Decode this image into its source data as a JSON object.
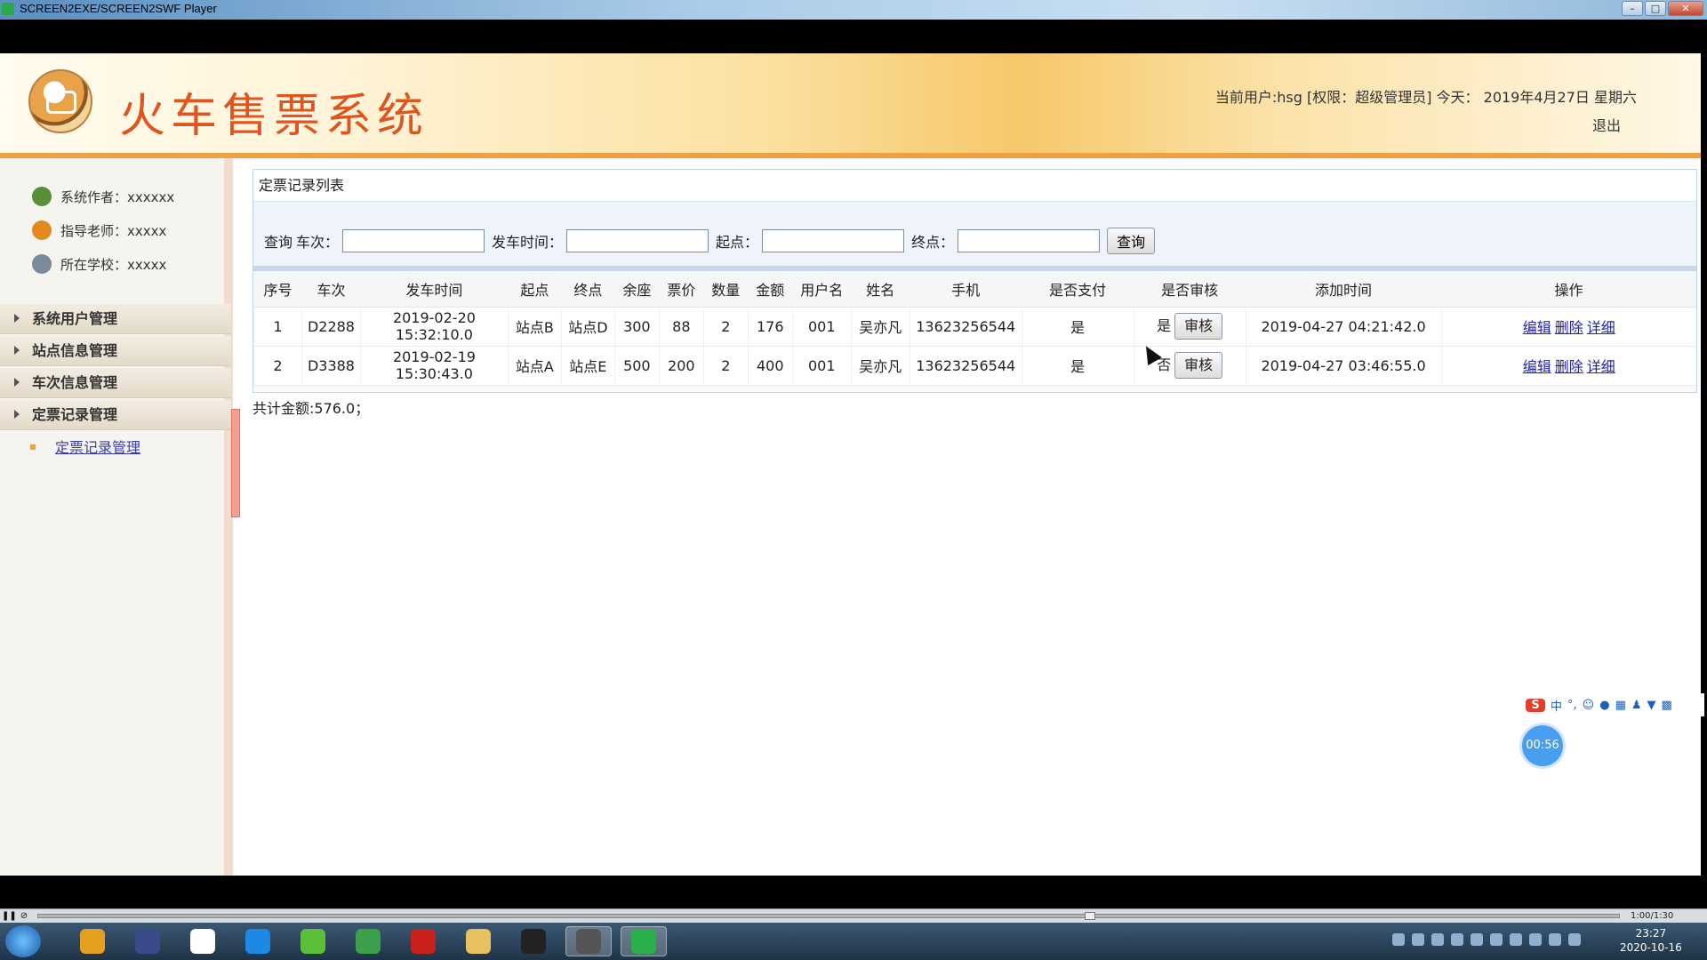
{
  "window": {
    "title": "SCREEN2EXE/SCREEN2SWF Player",
    "min": "–",
    "max": "□",
    "close": "✕"
  },
  "header": {
    "app_title": "火车售票系统",
    "user_info": "当前用户:hsg [权限：超级管理员] 今天： 2019年4月27日 星期六",
    "logout": "退出"
  },
  "sidebar": {
    "info": [
      {
        "text": "系统作者：xxxxxx",
        "icon": "users-icon",
        "color": "#5a8f3a"
      },
      {
        "text": "指导老师：xxxxx",
        "icon": "teacher-icon",
        "color": "#e08a20"
      },
      {
        "text": "所在学校：xxxxx",
        "icon": "school-icon",
        "color": "#7a8a9a"
      }
    ],
    "menus": [
      "系统用户管理",
      "站点信息管理",
      "车次信息管理",
      "定票记录管理"
    ],
    "submenu": "定票记录管理"
  },
  "panel": {
    "title": "定票记录列表",
    "search": {
      "prefix": "查询",
      "train_label": "车次：",
      "depart_label": "发车时间：",
      "from_label": "起点：",
      "to_label": "终点：",
      "button": "查询"
    },
    "columns": [
      "序号",
      "车次",
      "发车时间",
      "起点",
      "终点",
      "余座",
      "票价",
      "数量",
      "金额",
      "用户名",
      "姓名",
      "手机",
      "是否支付",
      "是否审核",
      "添加时间",
      "操作"
    ],
    "rows": [
      {
        "no": "1",
        "train": "D2288",
        "depart": "2019-02-20 15:32:10.0",
        "from": "站点B",
        "to": "站点D",
        "seats": "300",
        "price": "88",
        "qty": "2",
        "amount": "176",
        "username": "001",
        "name": "吴亦凡",
        "phone": "13623256544",
        "paid": "是",
        "audited": "是",
        "added": "2019-04-27 04:21:42.0"
      },
      {
        "no": "2",
        "train": "D3388",
        "depart": "2019-02-19 15:30:43.0",
        "from": "站点A",
        "to": "站点E",
        "seats": "500",
        "price": "200",
        "qty": "2",
        "amount": "400",
        "username": "001",
        "name": "吴亦凡",
        "phone": "13623256544",
        "paid": "是",
        "audited": "否",
        "added": "2019-04-27 03:46:55.0"
      }
    ],
    "audit_button": "审核",
    "actions": [
      "编辑",
      "删除",
      "详细"
    ],
    "total": "共计金额:576.0；"
  },
  "overlay": {
    "ime_label": "中",
    "ime_logo": "S",
    "timer": "00:56"
  },
  "player": {
    "time": "1:00/1:30"
  },
  "taskbar": {
    "apps": [
      {
        "icon": "chrome-icon",
        "color": "#e5a020"
      },
      {
        "icon": "editor-icon",
        "color": "#3a4a8a"
      },
      {
        "icon": "netdisk-icon",
        "color": "#ffffff"
      },
      {
        "icon": "browser-icon",
        "color": "#1e88e5"
      },
      {
        "icon": "leaf-icon",
        "color": "#5cbf3a"
      },
      {
        "icon": "chart-icon",
        "color": "#3aa04a"
      },
      {
        "icon": "flash-icon",
        "color": "#c8201a"
      },
      {
        "icon": "explorer-icon",
        "color": "#e8c060"
      },
      {
        "icon": "qq-icon",
        "color": "#222222"
      },
      {
        "icon": "avatar-icon",
        "color": "#555555"
      },
      {
        "icon": "player-icon",
        "color": "#2ab04a"
      }
    ],
    "clock_time": "23:27",
    "clock_date": "2020-10-16"
  }
}
